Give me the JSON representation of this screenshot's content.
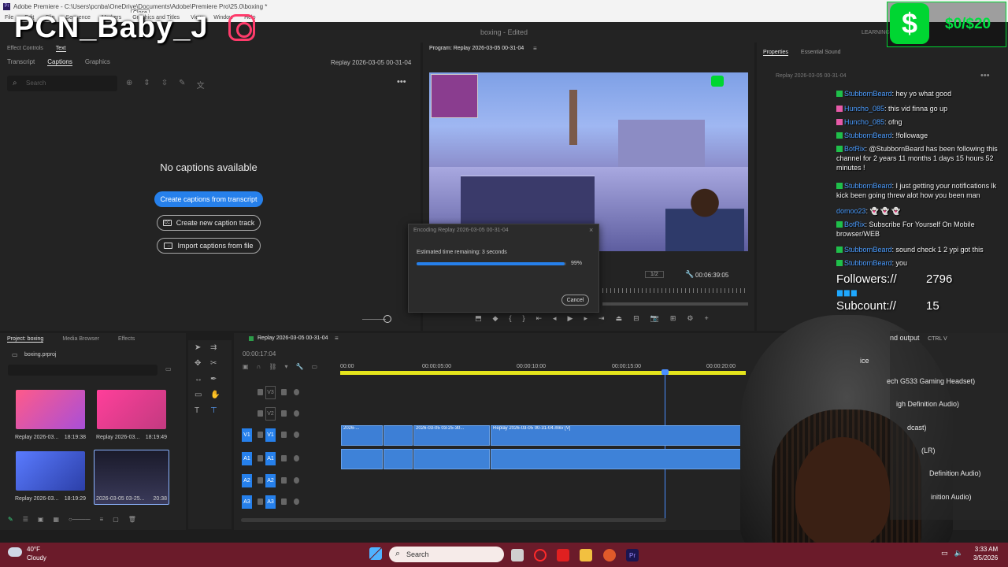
{
  "window": {
    "title": "Adobe Premiere - C:\\Users\\pcnba\\OneDrive\\Documents\\Adobe\\Premiere Pro\\25.0\\boxing *",
    "tooltip": "Close",
    "project_status": "boxing - Edited",
    "learning_label": "LEARNING"
  },
  "menu": [
    "File",
    "Edit",
    "Clip",
    "Sequence",
    "Markers",
    "Graphics and Titles",
    "View",
    "Window",
    "Help"
  ],
  "overlay": {
    "streamer_name": "PCN_Baby_J",
    "cashapp_goal": "$0/$20"
  },
  "left_panel": {
    "top_tabs": [
      "Effect Controls",
      "Text"
    ],
    "sub_tabs": [
      "Transcript",
      "Captions",
      "Graphics"
    ],
    "active_sub_tab": "Captions",
    "sequence_name": "Replay 2026-03-05 00-31-04",
    "search_placeholder": "Search",
    "empty_message": "No captions available",
    "btn_create_from_transcript": "Create captions from transcript",
    "btn_new_track": "Create new caption track",
    "btn_import": "Import captions from file"
  },
  "program": {
    "tab_label": "Program: Replay 2026-03-05 00-31-04",
    "resolution": "1/2",
    "timecode": "00:06:39:05"
  },
  "encode_dialog": {
    "title": "Encoding Replay 2026-03-05 00-31-04",
    "status": "Estimated time remaining: 3 seconds",
    "percent_label": "99%",
    "progress": 0.99,
    "cancel_label": "Cancel"
  },
  "properties": {
    "tabs": [
      "Properties",
      "Essential Sound"
    ],
    "item": "Replay 2026-03-05 00-31-04"
  },
  "chat": [
    {
      "user": "StubbornBeard",
      "text": ": hey yo what good",
      "badge": "green"
    },
    {
      "user": "Huncho_085",
      "text": ": this vid finna go up",
      "badge": "pink"
    },
    {
      "user": "Huncho_085",
      "text": ": ofng",
      "badge": "pink"
    },
    {
      "user": "StubbornBeard",
      "text": ": !followage",
      "badge": "green"
    },
    {
      "user": "BotRix",
      "text": ": @StubbornBeard has been following this channel for 2 years 11 months 1 days 15 hours 52 minutes !",
      "badge": "green"
    },
    {
      "user": "StubbornBeard",
      "text": ": I just getting your notifications lk kick been going threw alot how you been man",
      "badge": "green"
    },
    {
      "user": "domoo23",
      "text": ": 👻 👻 👻",
      "badge": "none"
    },
    {
      "user": "BotRix",
      "text": ": Subscribe For Yourself On Mobile browser/WEB",
      "badge": "green"
    },
    {
      "user": "StubbornBeard",
      "text": ": sound check 1 2 ypi got this",
      "badge": "green"
    },
    {
      "user": "StubbornBeard",
      "text": ": you",
      "badge": "green"
    }
  ],
  "stats": {
    "followers_label": "Followers://",
    "followers": "2796",
    "subcount_label": "Subcount://",
    "subcount": "15"
  },
  "sound_menu": {
    "header": "nd output",
    "shortcut": "CTRL  V",
    "items": [
      "ice",
      "ech G533 Gaming Headset)",
      "igh Definition Audio)",
      "dcast)",
      "(LR)",
      "Definition Audio)",
      "inition Audio)"
    ]
  },
  "project": {
    "tabs": [
      "Project: boxing",
      "Media Browser",
      "Effects"
    ],
    "file": "boxing.prproj",
    "items": [
      {
        "name": "Replay 2026-03...",
        "duration": "18:19:38"
      },
      {
        "name": "Replay 2026-03...",
        "duration": "18:19:49"
      },
      {
        "name": "Replay 2026-03...",
        "duration": "18:19:29"
      },
      {
        "name": "2026-03-05 03-25...",
        "duration": "20:38"
      }
    ]
  },
  "timeline": {
    "sequence_tab": "Replay 2026-03-05 00-31-04",
    "timecode": "00:00:17:04",
    "ruler": [
      "00:00",
      "00:00:05:00",
      "00:00:10:00",
      "00:00:15:00",
      "00:00:20:00"
    ],
    "video_tracks": [
      "V3",
      "V2",
      "V1"
    ],
    "audio_tracks": [
      "A1",
      "A2",
      "A3"
    ],
    "clips": [
      "2026-...",
      "2026-03-05 03-25-30...",
      "Replay 2026-03-05 00-31-04.mkv [V]"
    ]
  },
  "taskbar": {
    "weather_temp": "40°F",
    "weather_desc": "Cloudy",
    "search": "Search",
    "time": "3:33 AM",
    "date": "3/5/2026"
  }
}
